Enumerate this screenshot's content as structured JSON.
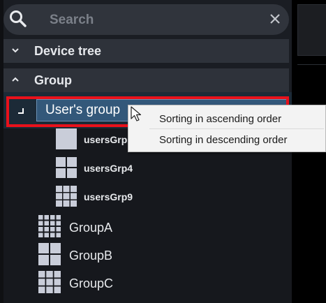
{
  "search": {
    "placeholder": "Search",
    "icon": "search-icon",
    "clear_icon": "close-icon"
  },
  "sections": {
    "device_tree": {
      "label": "Device tree",
      "icon": "chevron-down-icon"
    },
    "group": {
      "label": "Group",
      "icon": "chevron-up-icon"
    }
  },
  "selected_group": {
    "label": "User's group",
    "expander_icon": "tree-expander-icon"
  },
  "subgroups": [
    {
      "label": "usersGrp",
      "icon": "layout-1x1-icon"
    },
    {
      "label": "usersGrp4",
      "icon": "layout-2x2-icon"
    },
    {
      "label": "usersGrp9",
      "icon": "layout-3x3-icon"
    }
  ],
  "groups": [
    {
      "label": "GroupA",
      "icon": "layout-4x4-icon"
    },
    {
      "label": "GroupB",
      "icon": "layout-2x2-icon"
    },
    {
      "label": "GroupC",
      "icon": "layout-3x3-icon"
    }
  ],
  "context_menu": {
    "items": [
      {
        "label": "Sorting in ascending order"
      },
      {
        "label": "Sorting in descending order"
      }
    ]
  },
  "colors": {
    "panel_bg": "#1a1d23",
    "header_bg": "#2e323a",
    "selection_bg": "#33587a",
    "highlight_border": "#e8111b",
    "menu_bg": "#f3f3f3"
  }
}
